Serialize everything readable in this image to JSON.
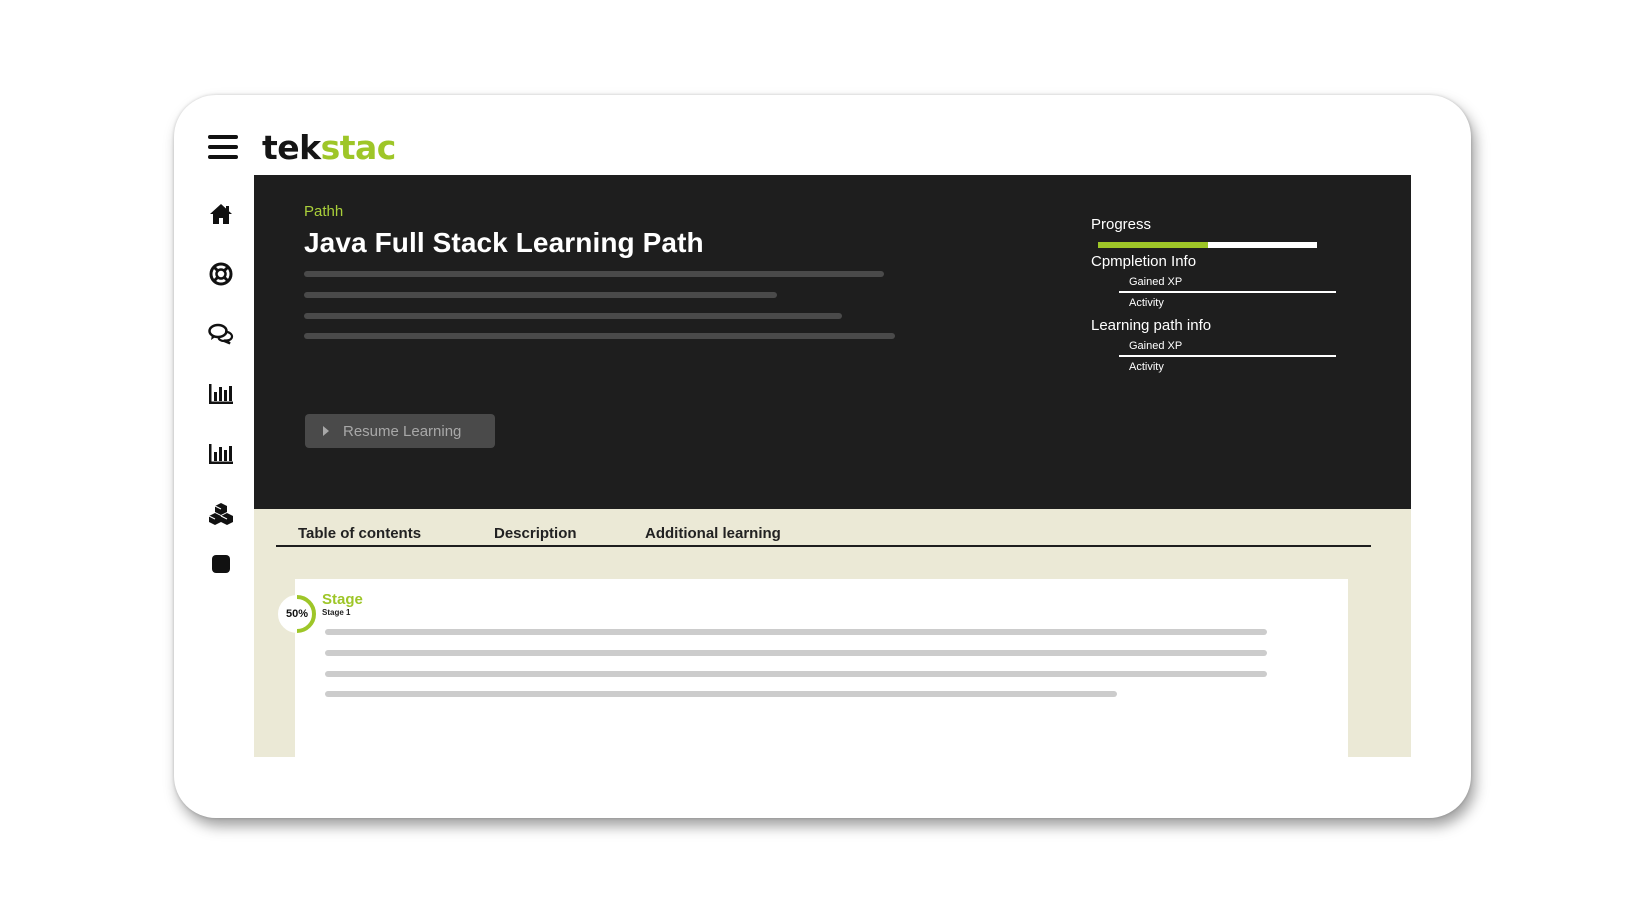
{
  "app": {
    "logo_part1": "tek",
    "logo_part2": "stac"
  },
  "sidebar": {
    "icons": [
      "home-icon",
      "support-lifebuoy-icon",
      "chat-icon",
      "analytics-icon",
      "reports-icon",
      "modules-cubes-icon",
      "stop-square-icon"
    ]
  },
  "hero": {
    "eyebrow": "Pathh",
    "title": "Java Full Stack Learning Path",
    "resume_label": "Resume Learning"
  },
  "stats": {
    "progress_label": "Progress",
    "progress_fraction": 0.5,
    "completion_heading": "Cpmpletion Info",
    "completion_gained": "Gained XP",
    "completion_activity": "Activity",
    "path_heading": "Learning path info",
    "path_gained": "Gained XP",
    "path_activity": "Activity"
  },
  "tabs": {
    "toc": "Table of contents",
    "description": "Description",
    "additional": "Additional learning"
  },
  "stage": {
    "percent_label": "50%",
    "percent_value": 50,
    "title": "Stage",
    "subtitle": "Stage 1"
  },
  "colors": {
    "accent": "#9ec628",
    "hero_bg": "#1e1e1e",
    "content_bg": "#ebe9d6"
  }
}
